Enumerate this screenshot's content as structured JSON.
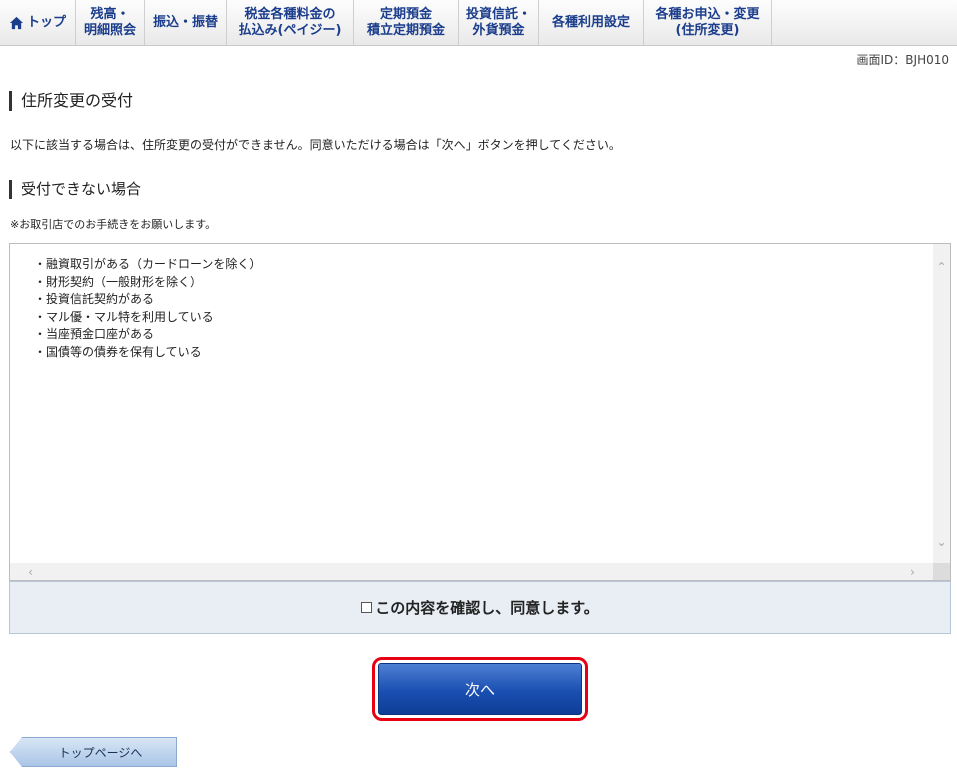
{
  "nav": {
    "items": [
      {
        "label": "トップ",
        "icon": "home-icon"
      },
      {
        "label": "残高・\n明細照会"
      },
      {
        "label": "振込・振替"
      },
      {
        "label": "税金各種料金の\n払込み(ペイジー)"
      },
      {
        "label": "定期預金\n積立定期預金"
      },
      {
        "label": "投資信託・\n外貨預金"
      },
      {
        "label": "各種利用設定"
      },
      {
        "label": "各種お申込・変更\n(住所変更)"
      }
    ]
  },
  "screen_id": "画面ID：BJH010",
  "page_title": "住所変更の受付",
  "description": "以下に該当する場合は、住所変更の受付ができません。同意いただける場合は「次へ」ボタンを押してください。",
  "section_title": "受付できない場合",
  "note": "※お取引店でのお手続きをお願いします。",
  "conditions": [
    "・融資取引がある（カードローンを除く）",
    "・財形契約（一般財形を除く）",
    "・投資信託契約がある",
    "・マル優・マル特を利用している",
    "・当座預金口座がある",
    "・国債等の債券を保有している"
  ],
  "agree_label": "この内容を確認し、同意します。",
  "next_label": "次へ",
  "back_label": "トップページへ",
  "colors": {
    "nav_text": "#1b3d8c",
    "highlight": "#e60012",
    "button": "#1a4fb1"
  }
}
